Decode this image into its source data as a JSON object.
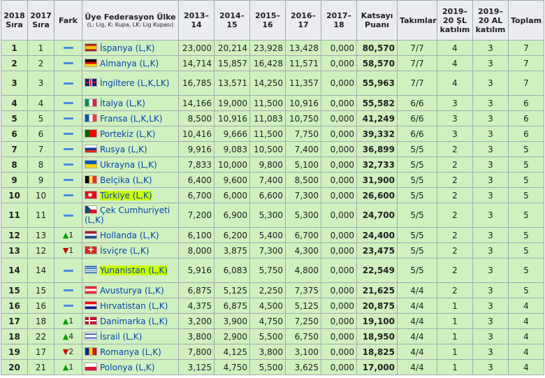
{
  "headers": {
    "rank2018": "2018 Sıra",
    "rank2017": "2017 Sıra",
    "fark": "Fark",
    "federation": "Üye Federasyon Ülke",
    "federation_note": "(L: Lig, K: Kupa, LK: Lig Kupası)",
    "y1314": "2013–14",
    "y1415": "2014–15",
    "y1516": "2015–16",
    "y1617": "2016–17",
    "y1718": "2017–18",
    "katsayi": "Katsayı Puanı",
    "takimlar": "Takımlar",
    "sl": "2019–20 ŞL katılım",
    "al": "2019–20 AL katılım",
    "toplam": "Toplam"
  },
  "colors": {
    "row_bg": "#d0f0c0",
    "header_bg": "#eaecf0",
    "highlight": "#ccff00",
    "up": "#00a000",
    "down": "#cc0000",
    "dash": "#4a8edb"
  },
  "rows": [
    {
      "r18": "1",
      "r17": "1",
      "change": "same",
      "delta": "",
      "flag": "f-es",
      "name": "İspanya (L,K)",
      "highlight": false,
      "tall": false,
      "v1": "23,000",
      "v2": "20,214",
      "v3": "23,928",
      "v4": "13,428",
      "v5": "0,000",
      "coef": "80,570",
      "teams": "7/7",
      "sl": "4",
      "al": "3",
      "total": "7"
    },
    {
      "r18": "2",
      "r17": "2",
      "change": "same",
      "delta": "",
      "flag": "f-de",
      "name": "Almanya (L,K)",
      "highlight": false,
      "tall": false,
      "v1": "14,714",
      "v2": "15,857",
      "v3": "16,428",
      "v4": "11,571",
      "v5": "0,000",
      "coef": "58,570",
      "teams": "7/7",
      "sl": "4",
      "al": "3",
      "total": "7"
    },
    {
      "r18": "3",
      "r17": "3",
      "change": "same",
      "delta": "",
      "flag": "f-gb",
      "name": "İngiltere (L,K,LK)",
      "highlight": false,
      "tall": true,
      "v1": "16,785",
      "v2": "13,571",
      "v3": "14,250",
      "v4": "11,357",
      "v5": "0,000",
      "coef": "55,963",
      "teams": "7/7",
      "sl": "4",
      "al": "3",
      "total": "7"
    },
    {
      "r18": "4",
      "r17": "4",
      "change": "same",
      "delta": "",
      "flag": "f-it",
      "name": "İtalya (L,K)",
      "highlight": false,
      "tall": false,
      "v1": "14,166",
      "v2": "19,000",
      "v3": "11,500",
      "v4": "10,916",
      "v5": "0,000",
      "coef": "55,582",
      "teams": "6/6",
      "sl": "3",
      "al": "3",
      "total": "6"
    },
    {
      "r18": "5",
      "r17": "5",
      "change": "same",
      "delta": "",
      "flag": "f-fr",
      "name": "Fransa (L,K,LK)",
      "highlight": false,
      "tall": false,
      "v1": "8,500",
      "v2": "10,916",
      "v3": "11,083",
      "v4": "10,750",
      "v5": "0,000",
      "coef": "41,249",
      "teams": "6/6",
      "sl": "3",
      "al": "3",
      "total": "6"
    },
    {
      "r18": "6",
      "r17": "6",
      "change": "same",
      "delta": "",
      "flag": "f-pt",
      "name": "Portekiz (L,K)",
      "highlight": false,
      "tall": false,
      "v1": "10,416",
      "v2": "9,666",
      "v3": "11,500",
      "v4": "7,750",
      "v5": "0,000",
      "coef": "39,332",
      "teams": "6/6",
      "sl": "3",
      "al": "3",
      "total": "6"
    },
    {
      "r18": "7",
      "r17": "7",
      "change": "same",
      "delta": "",
      "flag": "f-ru",
      "name": "Rusya (L,K)",
      "highlight": false,
      "tall": false,
      "v1": "9,916",
      "v2": "9,083",
      "v3": "10,500",
      "v4": "7,400",
      "v5": "0,000",
      "coef": "36,899",
      "teams": "5/5",
      "sl": "2",
      "al": "3",
      "total": "5"
    },
    {
      "r18": "8",
      "r17": "8",
      "change": "same",
      "delta": "",
      "flag": "f-ua",
      "name": "Ukrayna (L,K)",
      "highlight": false,
      "tall": false,
      "v1": "7,833",
      "v2": "10,000",
      "v3": "9,800",
      "v4": "5,100",
      "v5": "0,000",
      "coef": "32,733",
      "teams": "5/5",
      "sl": "2",
      "al": "3",
      "total": "5"
    },
    {
      "r18": "9",
      "r17": "9",
      "change": "same",
      "delta": "",
      "flag": "f-be",
      "name": "Belçika (L,K)",
      "highlight": false,
      "tall": false,
      "v1": "6,400",
      "v2": "9,600",
      "v3": "7,400",
      "v4": "8,500",
      "v5": "0,000",
      "coef": "31,900",
      "teams": "5/5",
      "sl": "2",
      "al": "3",
      "total": "5"
    },
    {
      "r18": "10",
      "r17": "10",
      "change": "same",
      "delta": "",
      "flag": "f-tr",
      "name": "Türkiye (L,K)",
      "highlight": true,
      "tall": false,
      "v1": "6,700",
      "v2": "6,000",
      "v3": "6,600",
      "v4": "7,300",
      "v5": "0,000",
      "coef": "26,600",
      "teams": "5/5",
      "sl": "2",
      "al": "3",
      "total": "5"
    },
    {
      "r18": "11",
      "r17": "11",
      "change": "same",
      "delta": "",
      "flag": "f-cz",
      "name": "Çek Cumhuriyeti (L,K)",
      "highlight": false,
      "tall": true,
      "v1": "7,200",
      "v2": "6,900",
      "v3": "5,300",
      "v4": "5,300",
      "v5": "0,000",
      "coef": "24,700",
      "teams": "5/5",
      "sl": "2",
      "al": "3",
      "total": "5"
    },
    {
      "r18": "12",
      "r17": "13",
      "change": "up",
      "delta": "1",
      "flag": "f-nl",
      "name": "Hollanda (L,K)",
      "highlight": false,
      "tall": false,
      "v1": "6,100",
      "v2": "6,200",
      "v3": "5,400",
      "v4": "6,700",
      "v5": "0,000",
      "coef": "24,400",
      "teams": "5/5",
      "sl": "2",
      "al": "3",
      "total": "5"
    },
    {
      "r18": "13",
      "r17": "12",
      "change": "down",
      "delta": "1",
      "flag": "f-ch",
      "name": "İsviçre (L,K)",
      "highlight": false,
      "tall": false,
      "v1": "8,000",
      "v2": "3,875",
      "v3": "7,300",
      "v4": "4,300",
      "v5": "0,000",
      "coef": "23,475",
      "teams": "5/5",
      "sl": "2",
      "al": "3",
      "total": "5"
    },
    {
      "r18": "14",
      "r17": "14",
      "change": "same",
      "delta": "",
      "flag": "f-gr",
      "name": "Yunanistan (L,K)",
      "highlight": true,
      "tall": true,
      "v1": "5,916",
      "v2": "6,083",
      "v3": "5,750",
      "v4": "4,800",
      "v5": "0,000",
      "coef": "22,549",
      "teams": "5/5",
      "sl": "2",
      "al": "3",
      "total": "5"
    },
    {
      "r18": "15",
      "r17": "15",
      "change": "same",
      "delta": "",
      "flag": "f-at",
      "name": "Avusturya (L,K)",
      "highlight": false,
      "tall": false,
      "v1": "6,875",
      "v2": "5,125",
      "v3": "2,250",
      "v4": "7,375",
      "v5": "0,000",
      "coef": "21,625",
      "teams": "4/4",
      "sl": "2",
      "al": "3",
      "total": "5"
    },
    {
      "r18": "16",
      "r17": "16",
      "change": "same",
      "delta": "",
      "flag": "f-hr",
      "name": "Hırvatistan (L,K)",
      "highlight": false,
      "tall": false,
      "v1": "4,375",
      "v2": "6,875",
      "v3": "4,500",
      "v4": "5,125",
      "v5": "0,000",
      "coef": "20,875",
      "teams": "4/4",
      "sl": "1",
      "al": "3",
      "total": "4"
    },
    {
      "r18": "17",
      "r17": "18",
      "change": "up",
      "delta": "1",
      "flag": "f-dk",
      "name": "Danimarka (L,K)",
      "highlight": false,
      "tall": false,
      "v1": "3,200",
      "v2": "3,900",
      "v3": "4,750",
      "v4": "7,250",
      "v5": "0,000",
      "coef": "19,100",
      "teams": "4/4",
      "sl": "1",
      "al": "3",
      "total": "4"
    },
    {
      "r18": "18",
      "r17": "22",
      "change": "up",
      "delta": "4",
      "flag": "f-il",
      "name": "İsrail (L,K)",
      "highlight": false,
      "tall": false,
      "v1": "3,800",
      "v2": "2,900",
      "v3": "5,500",
      "v4": "6,750",
      "v5": "0,000",
      "coef": "18,950",
      "teams": "4/4",
      "sl": "1",
      "al": "3",
      "total": "4"
    },
    {
      "r18": "19",
      "r17": "17",
      "change": "down",
      "delta": "2",
      "flag": "f-ro",
      "name": "Romanya (L,K)",
      "highlight": false,
      "tall": false,
      "v1": "7,800",
      "v2": "4,125",
      "v3": "3,800",
      "v4": "3,100",
      "v5": "0,000",
      "coef": "18,825",
      "teams": "4/4",
      "sl": "1",
      "al": "3",
      "total": "4"
    },
    {
      "r18": "20",
      "r17": "21",
      "change": "up",
      "delta": "1",
      "flag": "f-pl",
      "name": "Polonya (L,K)",
      "highlight": false,
      "tall": false,
      "v1": "3,125",
      "v2": "4,750",
      "v3": "5,500",
      "v4": "3,625",
      "v5": "0,000",
      "coef": "17,000",
      "teams": "4/4",
      "sl": "1",
      "al": "3",
      "total": "4"
    }
  ]
}
